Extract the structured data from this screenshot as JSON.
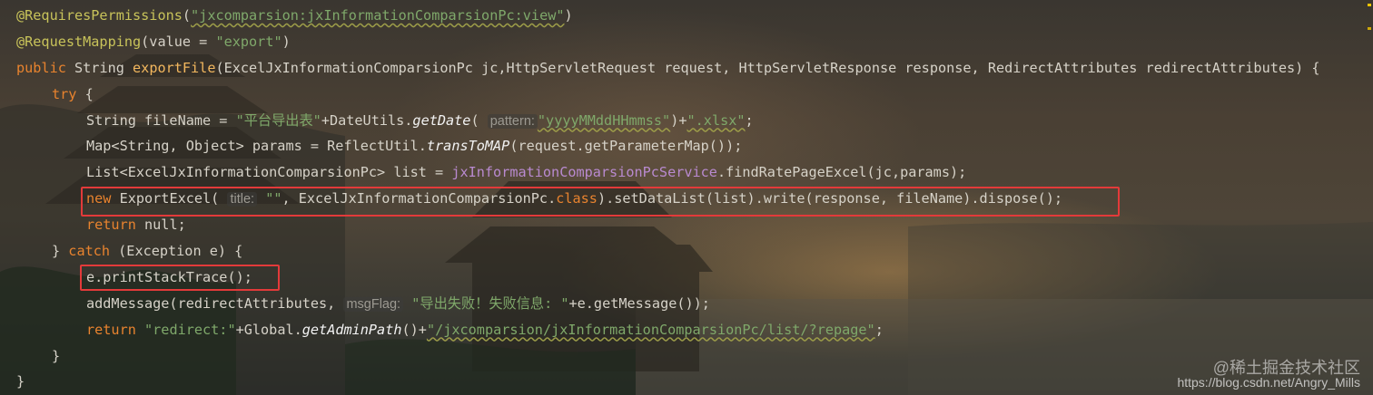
{
  "code_lines": {
    "l1": {
      "anno": "@RequiresPermissions",
      "open": "(",
      "str": "\"jxcomparsion:jxInformationComparsionPc:view\"",
      "close": ")"
    },
    "l2": {
      "anno": "@RequestMapping",
      "open": "(value = ",
      "str": "\"export\"",
      "close": ")"
    },
    "l3": {
      "kw": "public",
      "type": " String ",
      "fn": "exportFile",
      "params": "(ExcelJxInformationComparsionPc jc,HttpServletRequest request, HttpServletResponse response, RedirectAttributes redirectAttributes) {"
    },
    "l4": {
      "kw": "try",
      "rest": " {"
    },
    "l5": {
      "pre": "String fileName = ",
      "str": "\"平台导出表\"",
      "mid": "+DateUtils.",
      "st": "getDate",
      "open": "( ",
      "hint": "pattern:",
      "str2": "\"yyyyMMddHHmmss\"",
      "mid2": ")+",
      "str3": "\".xlsx\"",
      "end": ";"
    },
    "l6": {
      "pre": "Map<String, Object> params = ReflectUtil.",
      "st": "transToMAP",
      "rest": "(request.getParameterMap());"
    },
    "l7": {
      "pre": "List<ExcelJxInformationComparsionPc> list = ",
      "field": "jxInformationComparsionPcService",
      "rest": ".findRatePageExcel(jc,params);"
    },
    "l8": {
      "kw": "new",
      "pre": " ExportExcel( ",
      "hint": "title:",
      "str": " \"\"",
      "mid": ", ExcelJxInformationComparsionPc.",
      "kw2": "class",
      "rest": ").setDataList(list).write(response, fileName).dispose();"
    },
    "l9": {
      "kw": "return",
      "rest": " null;"
    },
    "l10": {
      "pre": "} ",
      "kw": "catch",
      "rest": " (Exception e) {"
    },
    "l11": {
      "text": "e.printStackTrace();"
    },
    "l12": {
      "pre": "addMessage(redirectAttributes, ",
      "hint": "msgFlag:",
      "str": " \"导出失败！失败信息: \"",
      "rest": "+e.getMessage());"
    },
    "l13": {
      "kw": "return",
      "str": " \"redirect:\"",
      "mid": "+Global.",
      "st": "getAdminPath",
      "mid2": "()+",
      "str2": "\"/jxcomparsion/jxInformationComparsionPc/list/?repage\"",
      "end": ";"
    },
    "l14": {
      "text": "}"
    },
    "l15": {
      "text": "}"
    }
  },
  "watermark": {
    "community": "@稀土掘金技术社区",
    "source": "https://blog.csdn.net/Angry_Mills"
  },
  "colors": {
    "highlight_box": "#e33a3a",
    "keyword": "#e8832e",
    "string": "#7fa86a",
    "method": "#f2b75e",
    "annotation": "#c8c35a"
  }
}
